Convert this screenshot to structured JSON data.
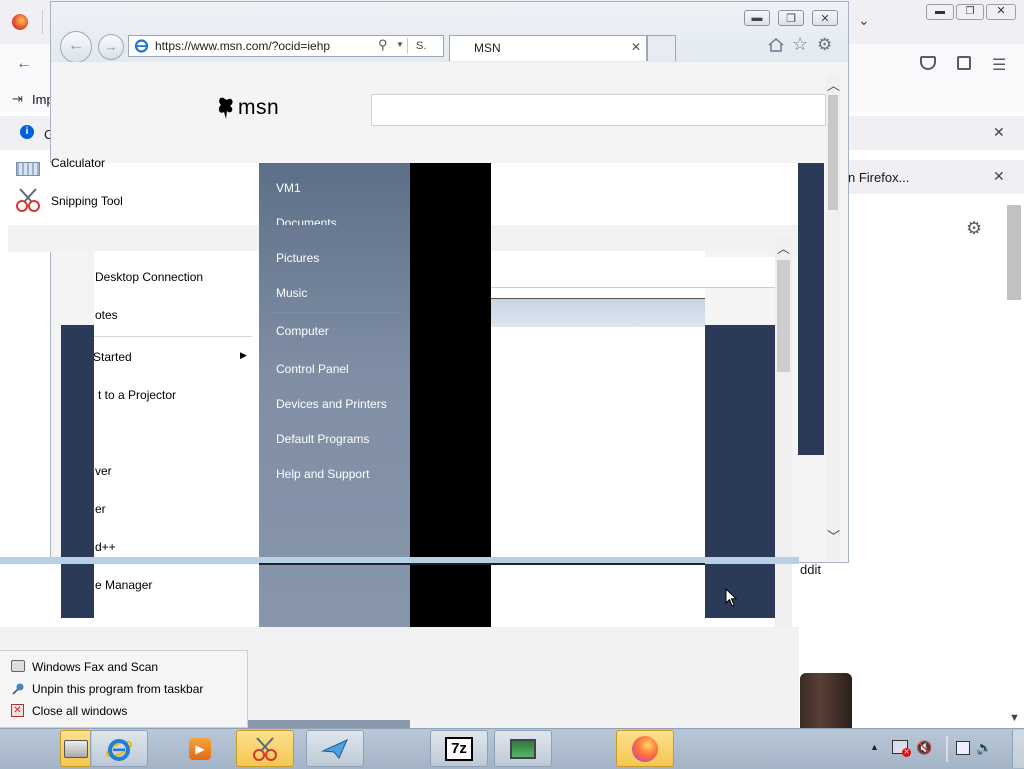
{
  "browser": {
    "url": "https://www.msn.com/?ocid=iehp",
    "search_hint": "S.",
    "tab_title": "MSN",
    "logo_text": "msn"
  },
  "firefox_bg": {
    "import_label": "Imp",
    "notif_label": "n Firefox...",
    "reddit_label": "ddit",
    "sidebar_letter": "C"
  },
  "start_menu": {
    "left_items": [
      {
        "label": "Calculator"
      },
      {
        "label": "Snipping Tool"
      },
      {
        "label": "Desktop Connection"
      },
      {
        "label": "otes"
      },
      {
        "label": "Started",
        "has_arrow": true
      },
      {
        "label": "t to a Projector"
      },
      {
        "label": "ver"
      },
      {
        "label": "er"
      },
      {
        "label": "d++"
      },
      {
        "label": "e Manager"
      }
    ],
    "right_items": [
      {
        "label": "VM1"
      },
      {
        "label": "Documents"
      },
      {
        "label": "Pictures"
      },
      {
        "label": "Music"
      },
      {
        "label": "Computer"
      },
      {
        "label": "Control Panel"
      },
      {
        "label": "Devices and Printers"
      },
      {
        "label": "Default Programs"
      },
      {
        "label": "Help and Support"
      }
    ]
  },
  "jump_list": {
    "items": [
      {
        "label": "Windows Fax and Scan",
        "icon": "fax-icon"
      },
      {
        "label": "Unpin this program from taskbar",
        "icon": "pin-icon"
      },
      {
        "label": "Close all windows",
        "icon": "close-window-icon"
      }
    ]
  },
  "taskbar": {
    "buttons": [
      {
        "name": "fax-scan-taskbar-button",
        "icon": "printer-icon",
        "active": true
      },
      {
        "name": "ie-taskbar-button",
        "icon": "internet-explorer-icon",
        "active": false
      },
      {
        "name": "media-player-taskbar-button",
        "icon": "media-player-icon",
        "active": false
      },
      {
        "name": "snipping-tool-taskbar-button",
        "icon": "scissors-icon",
        "active": true
      },
      {
        "name": "paper-plane-taskbar-button",
        "icon": "paper-plane-icon",
        "active": false
      },
      {
        "name": "7zip-taskbar-button",
        "icon": "7zip-icon",
        "active": false
      },
      {
        "name": "task-manager-taskbar-button",
        "icon": "monitor-icon",
        "active": false
      },
      {
        "name": "firefox-taskbar-button",
        "icon": "firefox-icon",
        "active": true
      }
    ],
    "seven_zip_label": "7z"
  },
  "colors": {
    "start_right": "#6f7f96",
    "navy": "#2c3a5a",
    "taskbar": "#a9b9cb",
    "active_button": "#f4c84f"
  }
}
